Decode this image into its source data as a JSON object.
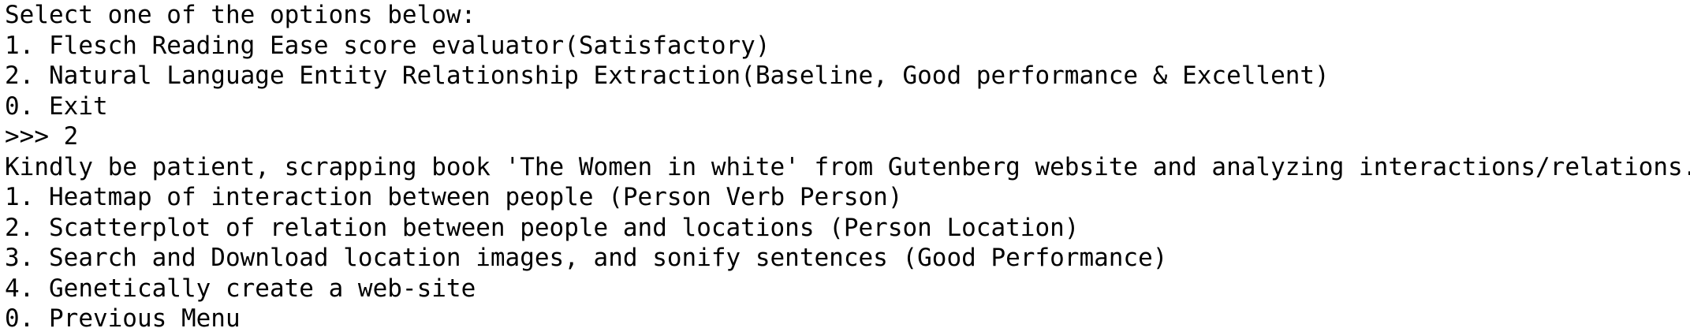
{
  "console": {
    "prompt_title": "Select one of the options below:",
    "main_menu": [
      "1. Flesch Reading Ease score evaluator(Satisfactory)",
      "2. Natural Language Entity Relationship Extraction(Baseline, Good performance & Excellent)",
      "0. Exit"
    ],
    "input_prompt": ">>> ",
    "input_value": "2",
    "status_message": "Kindly be patient, scrapping book 'The Women in white' from Gutenberg website and analyzing interactions/relations..",
    "sub_menu": [
      "1. Heatmap of interaction between people (Person Verb Person)",
      "2. Scatterplot of relation between people and locations (Person Location)",
      "3. Search and Download location images, and sonify sentences (Good Performance)",
      "4. Genetically create a web-site",
      "0. Previous Menu"
    ]
  }
}
